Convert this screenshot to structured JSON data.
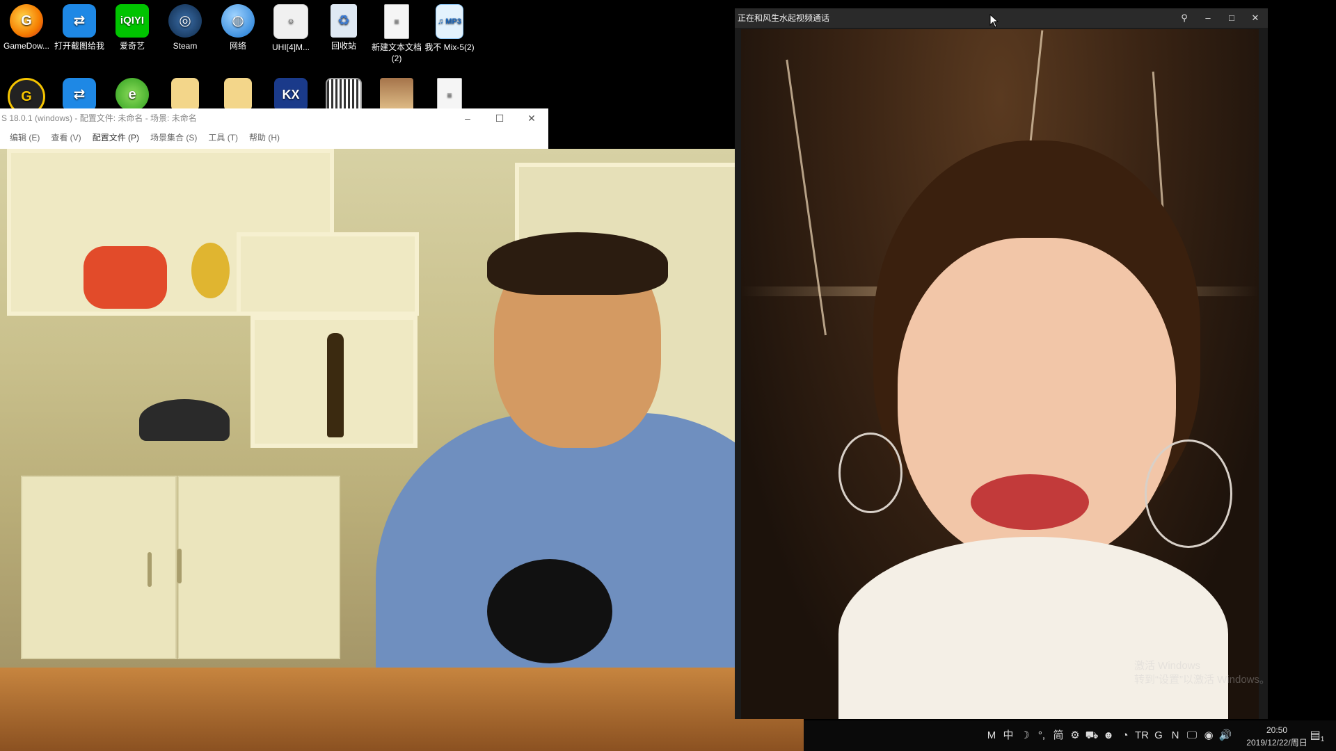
{
  "desktop": {
    "icons_row1": [
      {
        "label": "GameDow...",
        "icon": "gamedownload-icon",
        "glyph": "G"
      },
      {
        "label": "打开截图给我",
        "icon": "teamviewer-icon",
        "glyph": "⇄"
      },
      {
        "label": "爱奇艺",
        "icon": "iqiyi-icon",
        "glyph": "iQIYI"
      },
      {
        "label": "Steam",
        "icon": "steam-icon",
        "glyph": "◎"
      },
      {
        "label": "网络",
        "icon": "network-icon",
        "glyph": "◍"
      },
      {
        "label": "UHI[4]M...",
        "icon": "document-icon",
        "glyph": "☺"
      },
      {
        "label": "回收站",
        "icon": "recycle-bin-icon",
        "glyph": "♻"
      },
      {
        "label": "新建文本文档 (2)",
        "icon": "text-file-icon",
        "glyph": "≡"
      },
      {
        "label": "我不 Mix-5(2)",
        "icon": "mp3-file-icon",
        "glyph": "♫ MP3"
      }
    ],
    "icons_row2": [
      {
        "icon": "game-ring-icon",
        "glyph": "G"
      },
      {
        "icon": "teamviewer-icon",
        "glyph": "⇄"
      },
      {
        "icon": "ie-browser-icon",
        "glyph": "e"
      },
      {
        "icon": "folder-icon",
        "glyph": ""
      },
      {
        "icon": "folder-user-icon",
        "glyph": ""
      },
      {
        "icon": "kx-app-icon",
        "glyph": "KX"
      },
      {
        "icon": "qr-code-icon",
        "glyph": ""
      },
      {
        "icon": "photo-icon",
        "glyph": ""
      },
      {
        "icon": "text-file-icon",
        "glyph": "≡"
      }
    ]
  },
  "obs": {
    "title": "S 18.0.1 (windows) - 配置文件: 未命名 - 场景: 未命名",
    "menu": [
      "编辑 (E)",
      "查看 (V)",
      "配置文件 (P)",
      "场景集合 (S)",
      "工具 (T)",
      "帮助 (H)"
    ],
    "controls": {
      "minimize": "–",
      "maximize": "☐",
      "close": "✕"
    }
  },
  "call": {
    "title": "正在和风生水起视频通话",
    "controls": {
      "pin": "⚲",
      "minimize": "–",
      "maximize": "□",
      "close": "✕"
    },
    "watermark_line1": "激活 Windows",
    "watermark_line2": "转到“设置”以激活 Windows。"
  },
  "taskbar": {
    "tray": [
      "M",
      "中",
      "☽",
      "°,",
      "简",
      "⚙",
      "⛟",
      "☻",
      "◔",
      "TR",
      "G",
      "N",
      "🖵",
      "◉",
      "🔊"
    ],
    "time": "20:50",
    "date": "2019/12/22/周日",
    "notification_glyph": "▤",
    "notification_count": "1"
  },
  "colors": {
    "taskbar": "#0a0a0a",
    "call_titlebar": "#2a2a2a"
  }
}
